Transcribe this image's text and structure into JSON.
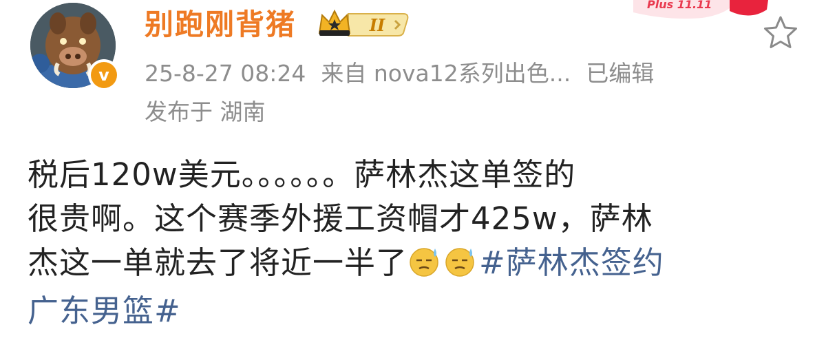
{
  "post": {
    "username": "别跑刚背猪",
    "level_badge": "II",
    "timestamp": "25-8-27 08:24",
    "source": "来自 nova12系列出色...",
    "edited": "已编辑",
    "location": "发布于 湖南",
    "verified_badge": "v",
    "promo_text": "Plus 11.11",
    "text_line1": "税后120w美元。。。。。。萨林杰这单签的",
    "text_line2": "很贵啊。这个赛季外援工资帽才425w，萨林",
    "text_line3": "杰这一单就去了将近一半了",
    "topic_part1": "#萨林杰签约",
    "topic_part2": "广东男篮#"
  },
  "icons": {
    "favorite": "star-outline-icon",
    "emoji": "sweat-emoji-icon",
    "crown": "crown-icon"
  },
  "colors": {
    "username": "#ee7a24",
    "meta": "#8d8d8d",
    "topic": "#45628f",
    "text": "#222222"
  }
}
